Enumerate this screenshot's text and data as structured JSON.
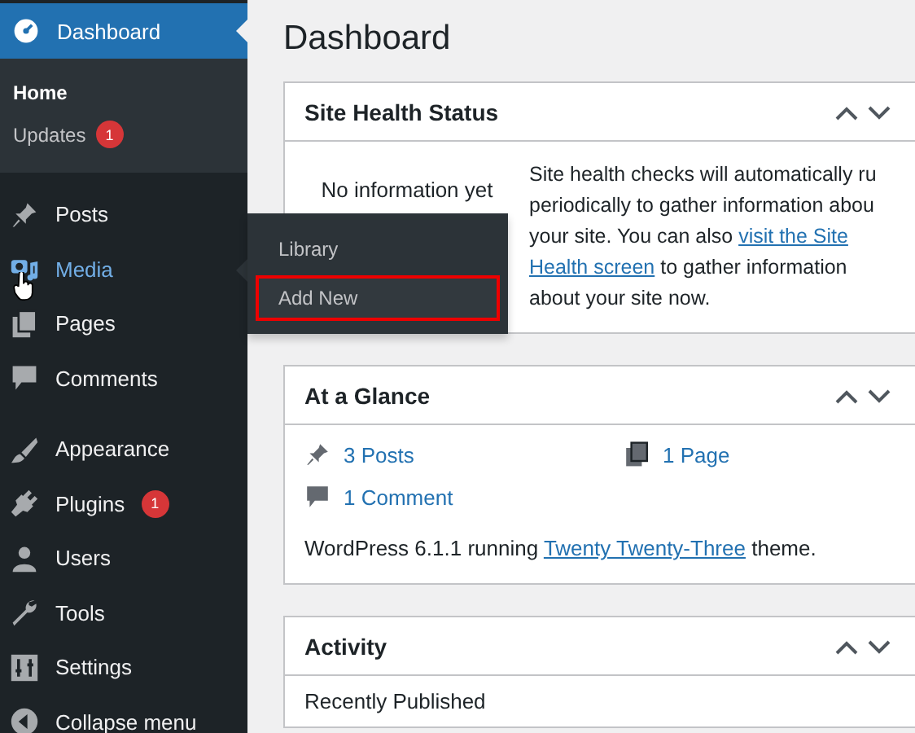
{
  "sidebar": {
    "current": {
      "label": "Dashboard",
      "selected": true
    },
    "submenu": [
      {
        "label": "Home",
        "selected": true
      },
      {
        "label": "Updates",
        "selected": false,
        "badge": "1"
      }
    ],
    "groups": [
      [
        {
          "label": "Posts",
          "hovered": false
        },
        {
          "label": "Media",
          "hovered": true
        },
        {
          "label": "Pages",
          "hovered": false
        },
        {
          "label": "Comments",
          "hovered": false
        }
      ],
      [
        {
          "label": "Appearance",
          "hovered": false
        },
        {
          "label": "Plugins",
          "hovered": false,
          "badge": "1"
        },
        {
          "label": "Users",
          "hovered": false
        },
        {
          "label": "Tools",
          "hovered": false
        },
        {
          "label": "Settings",
          "hovered": false
        },
        {
          "label": "Collapse menu",
          "hovered": false
        }
      ]
    ],
    "flyout": [
      {
        "label": "Library",
        "outlined": false
      },
      {
        "label": "Add New",
        "outlined": true
      }
    ]
  },
  "page_title": "Dashboard",
  "site_health": {
    "title": "Site Health Status",
    "status": "No information yet",
    "lines": [
      [
        {
          "kind": "text",
          "text": "Site health checks will automatically ru"
        }
      ],
      [
        {
          "kind": "text",
          "text": "periodically to gather information abou"
        }
      ],
      [
        {
          "kind": "text",
          "text": "your site. You can also "
        },
        {
          "kind": "link",
          "text": "visit the Site"
        }
      ],
      [
        {
          "kind": "link",
          "text": "Health screen"
        },
        {
          "kind": "text",
          "text": " to gather information"
        }
      ],
      [
        {
          "kind": "text",
          "text": "about your site now."
        }
      ]
    ]
  },
  "at_a_glance": {
    "title": "At a Glance",
    "stats": [
      {
        "label": "3 Posts"
      },
      {
        "label": "1 Page"
      },
      {
        "label": "1 Comment"
      }
    ],
    "version_before": "WordPress 6.1.1 running ",
    "theme": "Twenty Twenty-Three",
    "version_after": " theme."
  },
  "activity": {
    "title": "Activity",
    "subtitle": "Recently Published"
  }
}
